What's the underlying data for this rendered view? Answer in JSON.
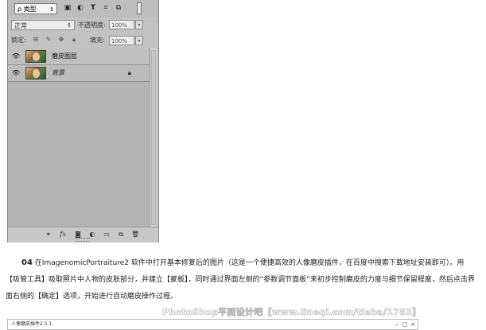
{
  "layers_panel": {
    "filter_label": "类型",
    "filter_icons": [
      "image-filter-icon",
      "adjustment-filter-icon",
      "type-filter-icon",
      "shape-filter-icon",
      "smart-object-filter-icon"
    ],
    "blend_mode": "正常",
    "opacity_label": "不透明度:",
    "opacity_value": "100%",
    "lock_label": "锁定:",
    "fill_label": "填充:",
    "fill_value": "100%",
    "layers": [
      {
        "name": "磨皮图层",
        "italic": false,
        "locked": false
      },
      {
        "name": "背景",
        "italic": true,
        "locked": true
      }
    ]
  },
  "instruction": {
    "step": "04",
    "text": "在ImagenomicPortraiture2 软件中打开基本修复后的图片（这是一个便捷高效的人像磨皮插件，在百度中搜索下载地址安装即可）。用【吸管工具】吸取照片中人物的皮肤部分，并建立【蒙板】，同时通过界面左侧的“参数调节面板”来初步控制磨皮的力度与细节保留程度，然后点击界面右侧的【确定】选项，开始进行自动磨皮操作过程。"
  },
  "watermark": "PhotoShop平面设计吧【www.lineqi.com/tieba/1783】",
  "window": {
    "title": "人像磨皮插件2.5.1"
  }
}
